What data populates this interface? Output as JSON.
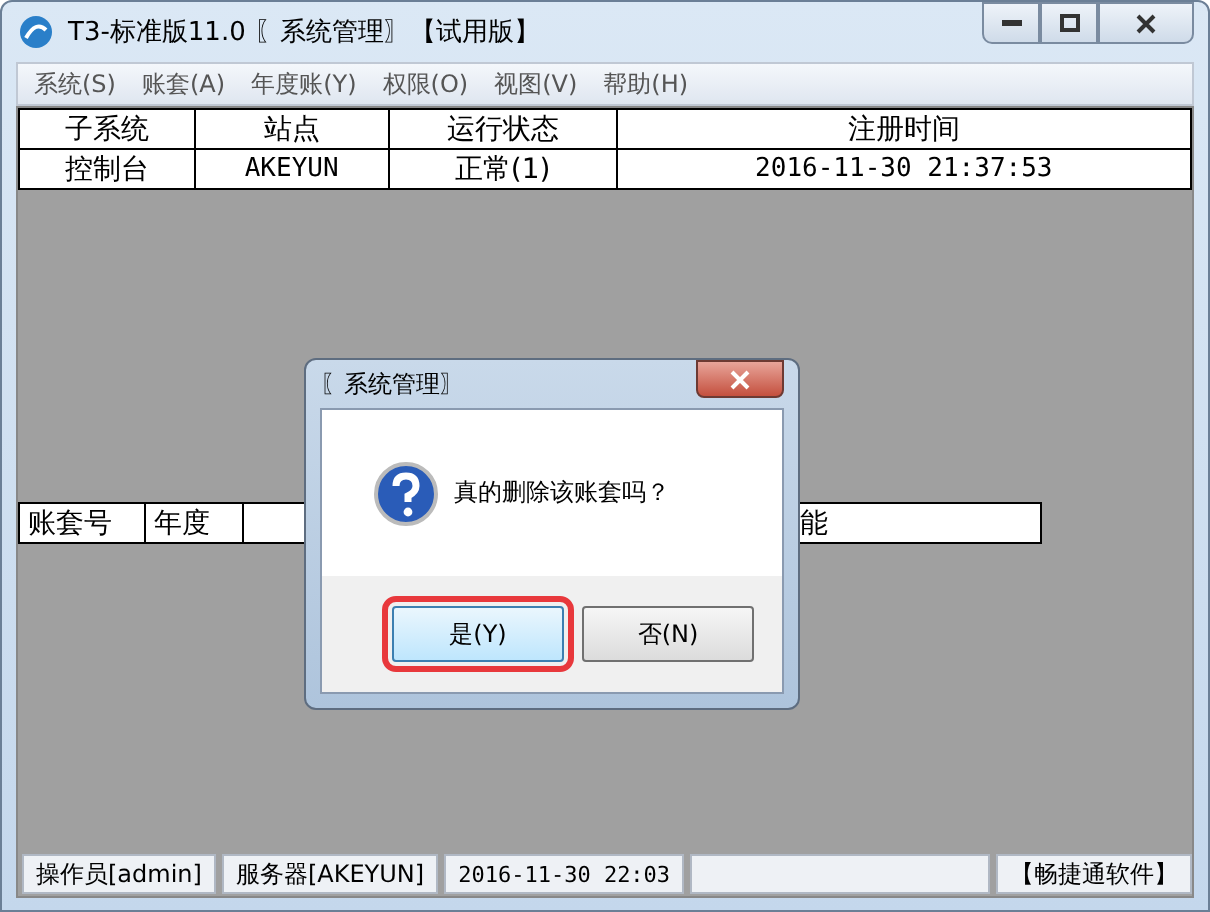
{
  "window": {
    "title": "T3-标准版11.0 〖系统管理〗【试用版】"
  },
  "menu": [
    "系统(S)",
    "账套(A)",
    "年度账(Y)",
    "权限(O)",
    "视图(V)",
    "帮助(H)"
  ],
  "sessions": {
    "columns": [
      "子系统",
      "站点",
      "运行状态",
      "注册时间"
    ],
    "rows": [
      [
        "控制台",
        "AKEYUN",
        "正常(1)",
        "2016-11-30 21:37:53"
      ]
    ]
  },
  "accounts": {
    "columns": [
      "账套号",
      "年度",
      "能"
    ]
  },
  "dialog": {
    "title": "〖系统管理〗",
    "message": "真的删除该账套吗？",
    "buttons": [
      {
        "label": "是(Y)",
        "selected": true
      },
      {
        "label": "否(N)",
        "selected": false
      }
    ]
  },
  "status_bar": [
    "操作员[admin]",
    "服务器[AKEYUN]",
    "2016-11-30 22:03",
    "【畅捷通软件】"
  ]
}
